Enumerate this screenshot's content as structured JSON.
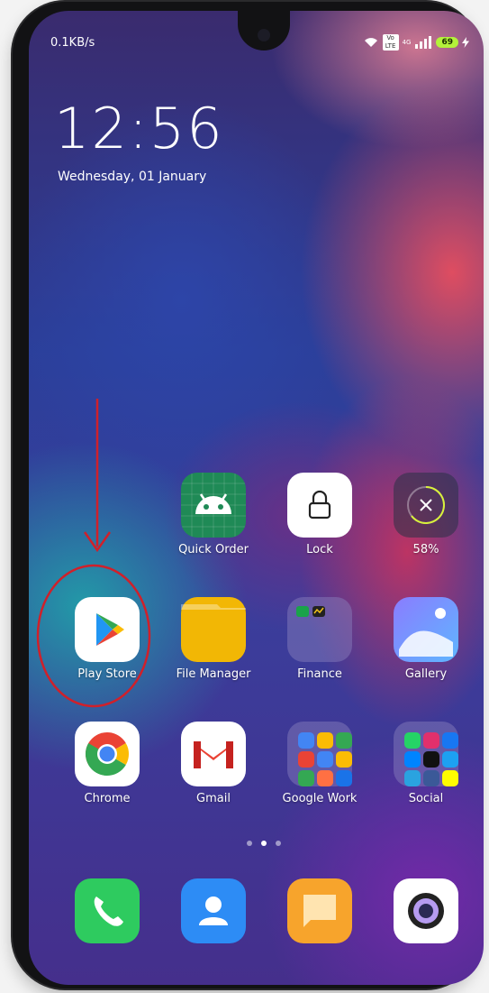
{
  "status_bar": {
    "net_speed": "0.1KB/s",
    "network_type": "4G",
    "volte_label": "Vo LTE",
    "battery": "69"
  },
  "clock": {
    "time": "12:56",
    "date": "Wednesday, 01 January"
  },
  "row1": [
    {
      "label": "Quick Order",
      "icon": "android-icon"
    },
    {
      "label": "Lock",
      "icon": "lock-icon"
    },
    {
      "label": "58%",
      "icon": "cleaner-icon"
    }
  ],
  "row2": [
    {
      "label": "Play Store",
      "icon": "play-store-icon"
    },
    {
      "label": "File Manager",
      "icon": "folder-icon"
    },
    {
      "label": "Finance",
      "icon": "finance-folder-icon"
    },
    {
      "label": "Gallery",
      "icon": "gallery-icon"
    }
  ],
  "row3": [
    {
      "label": "Chrome",
      "icon": "chrome-icon"
    },
    {
      "label": "Gmail",
      "icon": "gmail-icon"
    },
    {
      "label": "Google Work",
      "icon": "google-work-folder-icon"
    },
    {
      "label": "Social",
      "icon": "social-folder-icon"
    }
  ],
  "dock": [
    {
      "icon": "phone-icon"
    },
    {
      "icon": "contacts-icon"
    },
    {
      "icon": "messages-icon"
    },
    {
      "icon": "camera-icon"
    }
  ],
  "page_indicator": {
    "count": 3,
    "active": 1
  },
  "annotation": {
    "color": "#d0202a",
    "shape": "arrow-and-circle",
    "target": "play-store-icon"
  },
  "colors": {
    "android_green": "#1f8a56",
    "file_yellow": "#f2b705",
    "phone_green": "#2ecb5f",
    "contacts_blue": "#2d8cf5",
    "messages_orange": "#f7a42c"
  }
}
